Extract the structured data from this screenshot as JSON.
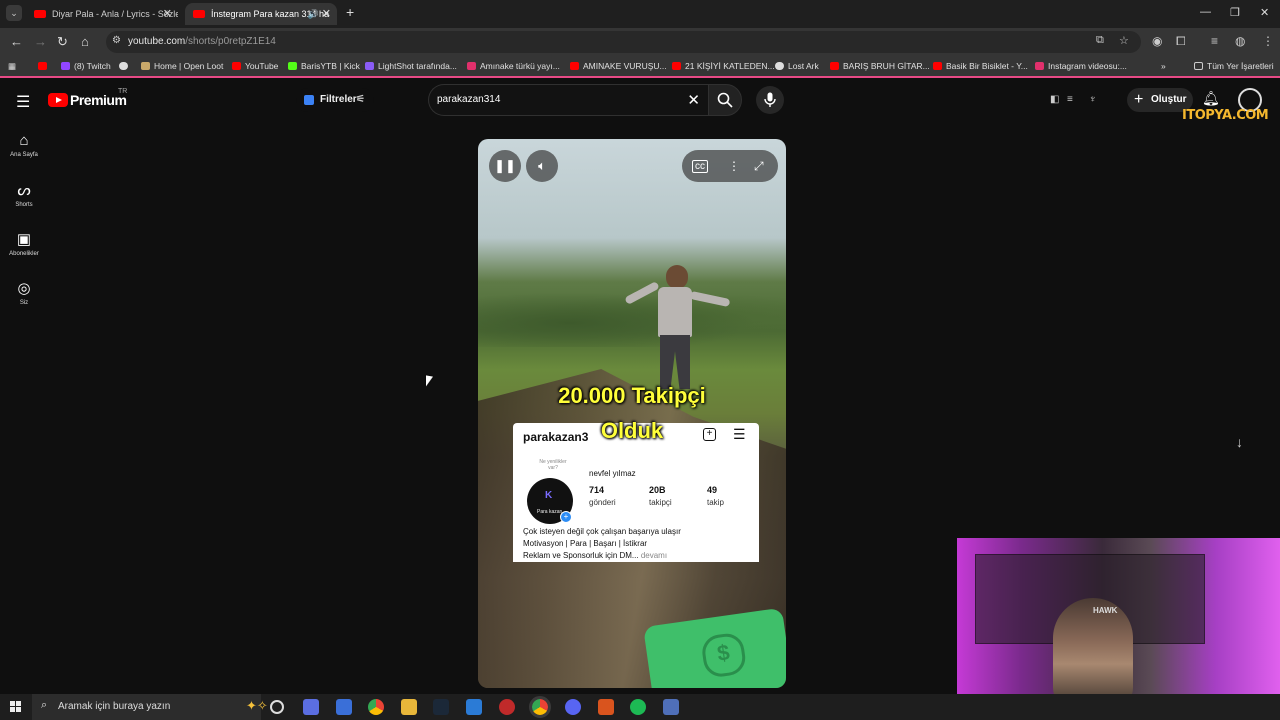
{
  "browser": {
    "tabs": [
      {
        "title": "Diyar Pala - Anla / Lyrics - Sözle"
      },
      {
        "title": "İnstegram Para kazan 314 ha"
      }
    ],
    "url_host": "youtube.com",
    "url_path": "/shorts/p0retpZ1E14",
    "bookmarks": [
      "(8) Twitch",
      "Home | Open Loot",
      "YouTube",
      "BarisYTB | Kick",
      "LightShot tarafında...",
      "Amınake türkü yayı...",
      "AMINAKE VURUŞU...",
      "21 KİŞİYİ KATLEDEN...",
      "Lost Ark",
      "BARIŞ BRUH GİTAR...",
      "Basik Bir Bisiklet - Y...",
      "Instagram videosu:..."
    ],
    "all_bookmarks": "Tüm Yer İşaretleri"
  },
  "youtube": {
    "logo_text": "Premium",
    "logo_country": "TR",
    "filters_label": "Filtreler",
    "search_value": "parakazan314",
    "create_label": "Oluştur",
    "sidebar": [
      {
        "label": "Ana Sayfa",
        "icon": "home-icon"
      },
      {
        "label": "Shorts",
        "icon": "shorts-icon"
      },
      {
        "label": "Abonelikler",
        "icon": "subscriptions-icon"
      },
      {
        "label": "Siz",
        "icon": "you-icon"
      }
    ]
  },
  "watermark": "ITOPYA.COM",
  "video": {
    "overlay_line1": "20.000 Takipçi",
    "overlay_line2": "Olduk",
    "instagram": {
      "username": "parakazan3",
      "note": "Ne yenilikler var?",
      "avatar_letter": "K",
      "avatar_caption": "Para kazan",
      "display_name": "nevfel yılmaz",
      "posts_value": "714",
      "posts_label": "gönderi",
      "followers_value": "20B",
      "followers_label": "takipçi",
      "following_value": "49",
      "following_label": "takip",
      "bio1": "Çok isteyen değil çok çalışan başarıya ulaşır",
      "bio2": "Motivasyon | Para | Başarı | İstikrar",
      "bio3": "Reklam ve Sponsorluk için DM...",
      "bio_more": "devamı"
    }
  },
  "webcam": {
    "shirt_text": "HAWK"
  },
  "taskbar": {
    "search_placeholder": "Aramak için buraya yazın"
  }
}
